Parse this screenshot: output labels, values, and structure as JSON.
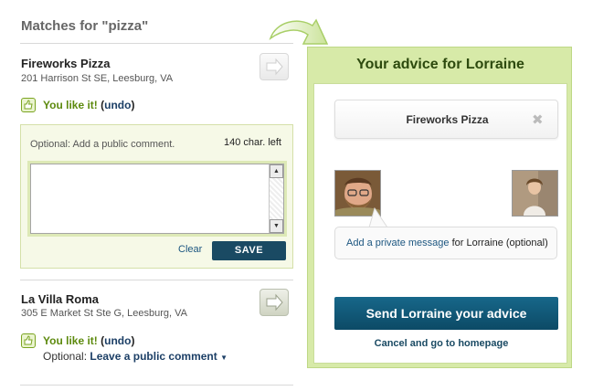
{
  "matches_title": "Matches for \"pizza\"",
  "results": [
    {
      "name": "Fireworks Pizza",
      "address": "201 Harrison St SE, Leesburg, VA",
      "like_text": "You like it!",
      "undo_label": "undo",
      "comment": {
        "optional_label": "Optional: Add a public comment.",
        "chars_left": "140 char. left",
        "value": "",
        "clear_label": "Clear",
        "save_label": "SAVE"
      }
    },
    {
      "name": "La Villa Roma",
      "address": "305 E Market St Ste G, Leesburg, VA",
      "like_text": "You like it!",
      "undo_label": "undo",
      "optional_prefix": "Optional:",
      "leave_comment_label": "Leave a public comment"
    }
  ],
  "advice_panel": {
    "title": "Your advice for Lorraine",
    "selected_restaurant": "Fireworks Pizza",
    "private_message_link": "Add a private message",
    "private_message_suffix": " for Lorraine (optional)",
    "send_label": "Send Lorraine your advice",
    "cancel_label": "Cancel and go to homepage"
  },
  "colors": {
    "panel_bg": "#d7eaa8",
    "like_green": "#5d8a0e",
    "button_dark": "#1a4a63",
    "send_teal": "#0c4a66"
  },
  "icons": [
    "arrow-right-icon",
    "thumbs-up-icon",
    "close-icon",
    "curved-arrow-icon",
    "chevron-down-icon"
  ]
}
